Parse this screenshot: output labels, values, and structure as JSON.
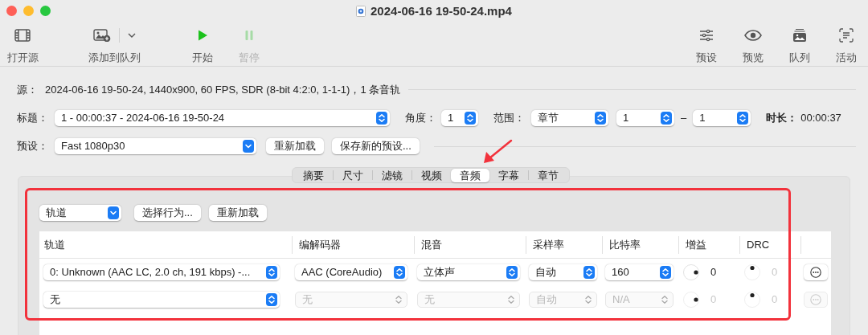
{
  "window": {
    "title": "2024-06-16 19-50-24.mp4"
  },
  "toolbar": [
    {
      "kind": "film",
      "label": "打开源",
      "disabled": false
    },
    {
      "kind": "addqueue",
      "label": "添加到队列",
      "disabled": false
    },
    {
      "kind": "start",
      "label": "开始",
      "disabled": false
    },
    {
      "kind": "pause",
      "label": "暂停",
      "disabled": true
    },
    {
      "kind": "presets",
      "label": "预设",
      "disabled": false
    },
    {
      "kind": "preview",
      "label": "预览",
      "disabled": false
    },
    {
      "kind": "queue",
      "label": "队列",
      "disabled": false
    },
    {
      "kind": "activity",
      "label": "活动",
      "disabled": false
    }
  ],
  "source": {
    "label": "源：",
    "value": "2024-06-16 19-50-24, 1440x900, 60 FPS, SDR (8-bit 4:2:0, 1-1-1)，1 条音轨"
  },
  "title_row": {
    "title": {
      "label": "标题：",
      "value": "1 - 00:00:37 - 2024-06-16 19-50-24"
    },
    "angle": {
      "label": "角度：",
      "value": "1"
    },
    "range": {
      "label": "范围：",
      "mode": "章节",
      "from": "1",
      "separator": "–",
      "to": "1"
    },
    "duration": {
      "label": "时长：",
      "value": "00:00:37"
    }
  },
  "preset_row": {
    "label": "预设：",
    "value": "Fast 1080p30",
    "buttons": [
      "重新加载",
      "保存新的预设..."
    ]
  },
  "tabs": [
    {
      "label": "摘要",
      "selected": false
    },
    {
      "label": "尺寸",
      "selected": false
    },
    {
      "label": "滤镜",
      "selected": false
    },
    {
      "label": "视频",
      "selected": false
    },
    {
      "label": "音频",
      "selected": true
    },
    {
      "label": "字幕",
      "selected": false
    },
    {
      "label": "章节",
      "selected": false
    }
  ],
  "audio": {
    "track_menu": "轨道",
    "buttons": [
      "选择行为...",
      "重新加载"
    ],
    "columns": [
      "轨道",
      "编解码器",
      "混音",
      "采样率",
      "比特率",
      "增益",
      "DRC"
    ],
    "rows": [
      {
        "track": {
          "value": "0: Unknown (AAC LC, 2.0 ch, 191 kbps) -...",
          "disabled": false
        },
        "codec": {
          "value": "AAC (CoreAudio)",
          "disabled": false
        },
        "mixdown": {
          "value": "立体声",
          "disabled": false
        },
        "samplerate": {
          "value": "自动",
          "disabled": false
        },
        "bitrate": {
          "value": "160",
          "disabled": false
        },
        "gain": {
          "value": "0",
          "disabled": false
        },
        "drc": {
          "value": "0",
          "disabled": true
        },
        "options_disabled": false
      },
      {
        "track": {
          "value": "无",
          "disabled": false
        },
        "codec": {
          "value": "无",
          "disabled": true
        },
        "mixdown": {
          "value": "无",
          "disabled": true
        },
        "samplerate": {
          "value": "自动",
          "disabled": true
        },
        "bitrate": {
          "value": "N/A",
          "disabled": true
        },
        "gain": {
          "value": "0",
          "disabled": true
        },
        "drc": {
          "value": "0",
          "disabled": true
        },
        "options_disabled": true
      }
    ]
  },
  "annotations": {
    "arrow": true,
    "highlight_box": true
  }
}
